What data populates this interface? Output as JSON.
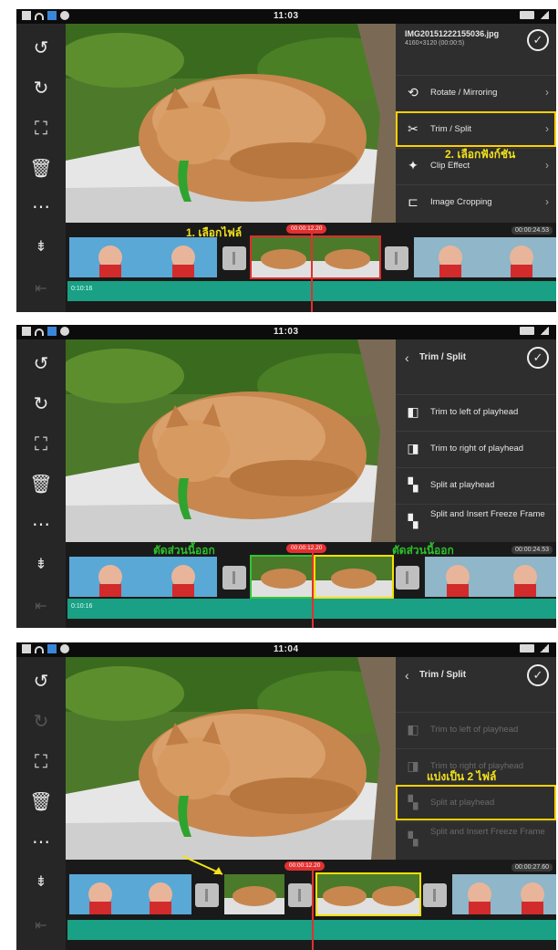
{
  "panels": [
    {
      "status_time": "11:03",
      "header_title": "IMG20151222155036.jpg",
      "header_sub": "4160×3120 (00:00:5)",
      "menu": [
        {
          "icon": "⟲",
          "label": "Rotate / Mirroring"
        },
        {
          "icon": "✂",
          "label": "Trim / Split"
        },
        {
          "icon": "✦",
          "label": "Clip Effect"
        },
        {
          "icon": "⊏",
          "label": "Image Cropping"
        }
      ],
      "playhead_time": "00:00:12.20",
      "total_time": "00:00:24.53",
      "audio_label": "0:10:16",
      "annotation_1": "1. เลือกไฟล์",
      "annotation_2": "2. เลือกฟังก์ชัน"
    },
    {
      "status_time": "11:03",
      "back_title": "Trim / Split",
      "menu": [
        {
          "label": "Trim to left of playhead"
        },
        {
          "label": "Trim to right of playhead"
        },
        {
          "label": "Split at playhead"
        },
        {
          "label": "Split and Insert Freeze Frame"
        }
      ],
      "playhead_time": "00:00:12.20",
      "total_time": "00:00:24.53",
      "audio_label": "0:10:16",
      "annotation_left": "ตัดส่วนนี้ออก",
      "annotation_right": "ตัดส่วนนี้ออก"
    },
    {
      "status_time": "11:04",
      "back_title": "Trim / Split",
      "menu": [
        {
          "label": "Trim to left of playhead"
        },
        {
          "label": "Trim to right of playhead"
        },
        {
          "label": "Split at playhead"
        },
        {
          "label": "Split and Insert Freeze Frame"
        }
      ],
      "playhead_time": "00:00:12.20",
      "total_time": "00:00:27.60",
      "annotation": "แบ่งเป็น 2 ไฟล์"
    }
  ]
}
